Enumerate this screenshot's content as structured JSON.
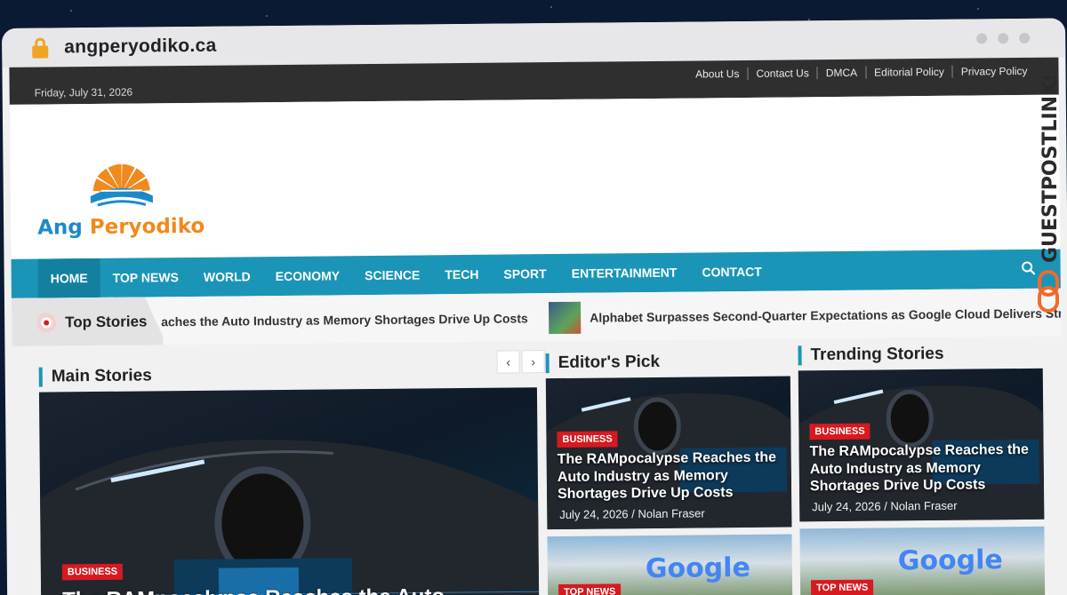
{
  "browser": {
    "url": "angperyodiko.ca"
  },
  "topbar": {
    "date": "Friday, July 31, 2026",
    "links": [
      "About Us",
      "Contact Us",
      "DMCA",
      "Editorial Policy",
      "Privacy Policy"
    ]
  },
  "logo": {
    "word1": "Ang",
    "word2": "Peryodiko"
  },
  "nav": {
    "items": [
      "HOME",
      "TOP NEWS",
      "WORLD",
      "ECONOMY",
      "SCIENCE",
      "TECH",
      "SPORT",
      "ENTERTAINMENT",
      "CONTACT"
    ]
  },
  "ticker": {
    "label": "Top Stories",
    "item1": "aches the Auto Industry as Memory Shortages Drive Up Costs",
    "item2": "Alphabet Surpasses Second-Quarter Expectations as Google Cloud Delivers Stron"
  },
  "sections": {
    "main": "Main Stories",
    "editors": "Editor's Pick",
    "trending": "Trending Stories"
  },
  "main_story": {
    "badge": "BUSINESS",
    "title": "The RAMpocalypse Reaches the Auto"
  },
  "editors_pick": {
    "badge": "BUSINESS",
    "title": "The RAMpocalypse Reaches the Auto Industry as Memory Shortages Drive Up Costs",
    "date": "July 24, 2026",
    "author": "Nolan Fraser",
    "badge2": "TOP NEWS"
  },
  "trending": {
    "badge": "BUSINESS",
    "title": "The RAMpocalypse Reaches the Auto Industry as Memory Shortages Drive Up Costs",
    "date": "July 24, 2026",
    "author": "Nolan Fraser",
    "badge2": "TOP NEWS"
  },
  "google_word": "Google",
  "watermark": "GUESTPOSTLINKS",
  "colors": {
    "accent": "#1a95b8",
    "badge": "#d71920",
    "logo_blue": "#1b8ac9",
    "logo_orange": "#f08a1c"
  }
}
